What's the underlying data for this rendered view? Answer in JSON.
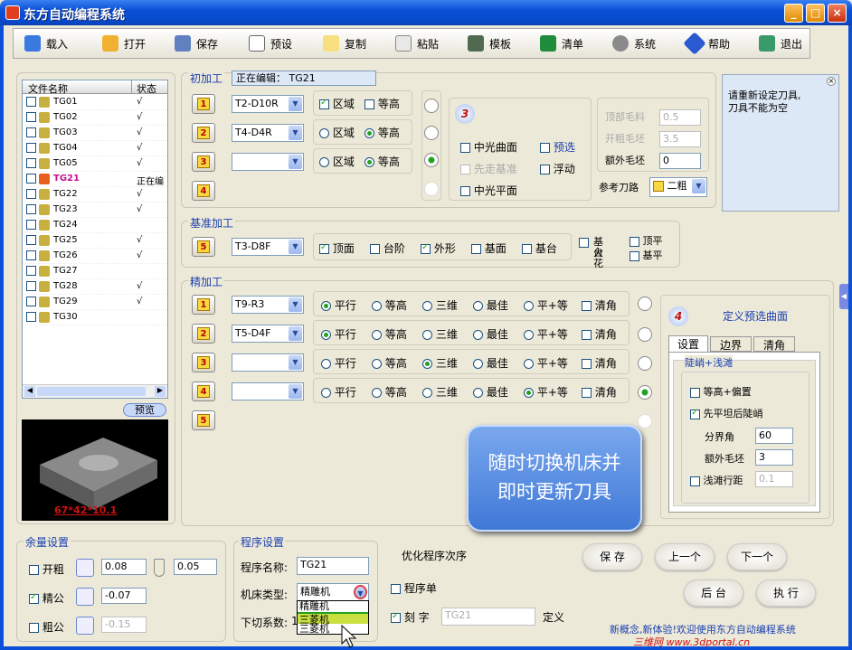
{
  "app": {
    "title": "东方自动编程系统",
    "win_min": "_",
    "win_max": "□",
    "win_close": "×"
  },
  "toolbar": [
    "载入",
    "打开",
    "保存",
    "预设",
    "复制",
    "粘贴",
    "模板",
    "清单",
    "系统",
    "帮助",
    "退出"
  ],
  "filelist": {
    "col_name": "文件名称",
    "col_status": "状态",
    "rows": [
      {
        "name": "TG01",
        "status": "√"
      },
      {
        "name": "TG02",
        "status": "√"
      },
      {
        "name": "TG03",
        "status": "√"
      },
      {
        "name": "TG04",
        "status": "√"
      },
      {
        "name": "TG05",
        "status": "√"
      },
      {
        "name": "TG21",
        "status": "正在编"
      },
      {
        "name": "TG22",
        "status": "√"
      },
      {
        "name": "TG23",
        "status": "√"
      },
      {
        "name": "TG24",
        "status": ""
      },
      {
        "name": "TG25",
        "status": "√"
      },
      {
        "name": "TG26",
        "status": "√"
      },
      {
        "name": "TG27",
        "status": ""
      },
      {
        "name": "TG28",
        "status": "√"
      },
      {
        "name": "TG29",
        "status": "√"
      },
      {
        "name": "TG30",
        "status": ""
      }
    ]
  },
  "preview_btn": "预览",
  "preview_caption": "67*42*10.1",
  "rough": {
    "label": "初加工",
    "editing_label": "正在编辑：",
    "editing_value": "TG21",
    "rows": [
      {
        "n": "1",
        "tool": "T2-D10R",
        "opt1": "区域",
        "opt2": "等高"
      },
      {
        "n": "2",
        "tool": "T4-D4R",
        "opt1": "区域",
        "opt2": "等高"
      },
      {
        "n": "3",
        "tool": "",
        "opt1": "区域",
        "opt2": "等高"
      },
      {
        "n": "4"
      }
    ],
    "c3_badge": "3",
    "opts": {
      "a": "中光曲面",
      "b": "预选",
      "c": "先走基准",
      "d": "浮动",
      "e": "中光平面"
    },
    "top_stock_label": "顶部毛料",
    "top_stock": "0.5",
    "open_stock_label": "开粗毛坯",
    "open_stock": "3.5",
    "extra_stock_label": "额外毛坯",
    "extra_stock": "0",
    "ref_tool_label": "参考刀路",
    "ref_tool_value": "二粗"
  },
  "notice": {
    "text": "请重新设定刀具,\n刀具不能为空"
  },
  "base": {
    "label": "基准加工",
    "n": "5",
    "tool": "T3-D8F",
    "opts": [
      "顶面",
      "台阶",
      "外形",
      "基面",
      "基台"
    ],
    "opt6a": "基台",
    "opt6b": "火花",
    "opt7": "顶平",
    "opt8": "基平"
  },
  "finish": {
    "label": "精加工",
    "rows": [
      {
        "n": "1",
        "tool": "T9-R3"
      },
      {
        "n": "2",
        "tool": "T5-D4F"
      },
      {
        "n": "3",
        "tool": ""
      },
      {
        "n": "4",
        "tool": ""
      },
      {
        "n": "5"
      }
    ],
    "opts": [
      "平行",
      "等高",
      "三维",
      "最佳",
      "平+等",
      "清角"
    ]
  },
  "define": {
    "badge": "4",
    "title": "定义预选曲面",
    "tabs": [
      "设置",
      "边界",
      "清角"
    ],
    "group": "陡峭+浅滩",
    "opt1": "等高+偏置",
    "opt2": "先平坦后陡峭",
    "boundary_label": "分界角",
    "boundary": "60",
    "extra_label": "额外毛坯",
    "extra": "3",
    "shallow_label": "浅滩行距",
    "shallow": "0.1"
  },
  "callout": "随时切换机床并\n即时更新刀具",
  "margin": {
    "label": "余量设置",
    "rows": [
      {
        "name": "开粗",
        "v1": "0.08",
        "v2": "0.05"
      },
      {
        "name": "精公",
        "v1": "-0.07"
      },
      {
        "name": "粗公",
        "v1": "-0.15"
      }
    ]
  },
  "program": {
    "label": "程序设置",
    "name_label": "程序名称:",
    "name": "TG21",
    "machine_label": "机床类型:",
    "machine": "精雕机",
    "feed_label": "下切系数:",
    "feed": "1",
    "options": [
      "精雕机",
      "三菱机",
      "三菱机"
    ]
  },
  "optimize": {
    "label": "优化程序次序",
    "list_label": "程序单",
    "engrave_label": "刻 字",
    "engrave_value": "TG21",
    "define_label": "定义"
  },
  "buttons": {
    "save": "保 存",
    "prev": "上一个",
    "next": "下一个",
    "back": "后 台",
    "run": "执 行"
  },
  "footer": "新概念,新体验!欢迎使用东方自动编程系统",
  "watermark": "三维网 www.3dportal.cn"
}
